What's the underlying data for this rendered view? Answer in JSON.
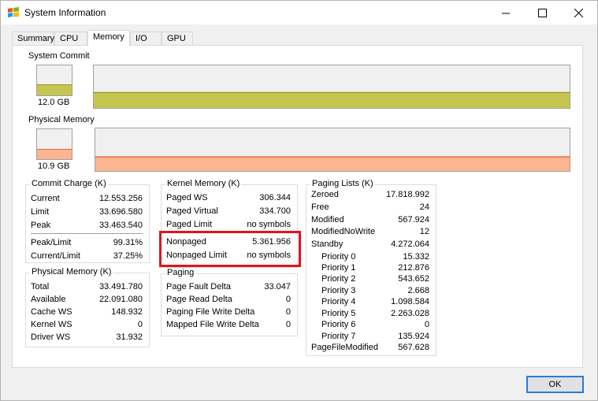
{
  "window": {
    "title": "System Information",
    "app_icon": "windows-flag-icon"
  },
  "tabs": [
    {
      "label": "Summary"
    },
    {
      "label": "CPU"
    },
    {
      "label": "Memory"
    },
    {
      "label": "I/O"
    },
    {
      "label": "GPU"
    }
  ],
  "system_commit": {
    "label": "System Commit",
    "value": "12.0 GB",
    "fill_fraction": 0.36,
    "color_fill": "#c5c652",
    "color_line": "#9a9c2a"
  },
  "physical_memory_graph": {
    "label": "Physical Memory",
    "value": "10.9 GB",
    "fill_fraction": 0.33,
    "color_fill": "#fbb590",
    "color_line": "#e8693b"
  },
  "commit_charge": {
    "title": "Commit Charge (K)",
    "rows": [
      {
        "k": "Current",
        "v": "12.553.256"
      },
      {
        "k": "Limit",
        "v": "33.696.580"
      },
      {
        "k": "Peak",
        "v": "33.463.540"
      }
    ],
    "rows2": [
      {
        "k": "Peak/Limit",
        "v": "99.31%"
      },
      {
        "k": "Current/Limit",
        "v": "37.25%"
      }
    ]
  },
  "physical_memory": {
    "title": "Physical Memory (K)",
    "rows": [
      {
        "k": "Total",
        "v": "33.491.780"
      },
      {
        "k": "Available",
        "v": "22.091.080"
      },
      {
        "k": "Cache WS",
        "v": "148.932"
      },
      {
        "k": "Kernel WS",
        "v": "0"
      },
      {
        "k": "Driver WS",
        "v": "31.932"
      }
    ]
  },
  "kernel_memory": {
    "title": "Kernel Memory (K)",
    "rows": [
      {
        "k": "Paged WS",
        "v": "306.344"
      },
      {
        "k": "Paged Virtual",
        "v": "334.700"
      },
      {
        "k": "Paged Limit",
        "v": "no symbols"
      }
    ],
    "rows2": [
      {
        "k": "Nonpaged",
        "v": "5.361.956"
      },
      {
        "k": "Nonpaged Limit",
        "v": "no symbols"
      }
    ]
  },
  "paging": {
    "title": "Paging",
    "rows": [
      {
        "k": "Page Fault Delta",
        "v": "33.047"
      },
      {
        "k": "Page Read Delta",
        "v": "0"
      },
      {
        "k": "Paging File Write Delta",
        "v": "0"
      },
      {
        "k": "Mapped File Write Delta",
        "v": "0"
      }
    ]
  },
  "paging_lists": {
    "title": "Paging Lists (K)",
    "rows": [
      {
        "k": "Zeroed",
        "v": "17.818.992"
      },
      {
        "k": "Free",
        "v": "24"
      },
      {
        "k": "Modified",
        "v": "567.924"
      },
      {
        "k": "ModifiedNoWrite",
        "v": "12"
      },
      {
        "k": "Standby",
        "v": "4.272.064"
      }
    ],
    "priorities": [
      {
        "k": "Priority 0",
        "v": "15.332"
      },
      {
        "k": "Priority 1",
        "v": "212.876"
      },
      {
        "k": "Priority 2",
        "v": "543.652"
      },
      {
        "k": "Priority 3",
        "v": "2.668"
      },
      {
        "k": "Priority 4",
        "v": "1.098.584"
      },
      {
        "k": "Priority 5",
        "v": "2.263.028"
      },
      {
        "k": "Priority 6",
        "v": "0"
      },
      {
        "k": "Priority 7",
        "v": "135.924"
      }
    ],
    "footer": {
      "k": "PageFileModified",
      "v": "567.628"
    }
  },
  "buttons": {
    "ok": "OK"
  },
  "highlight_color": "#e1141e"
}
